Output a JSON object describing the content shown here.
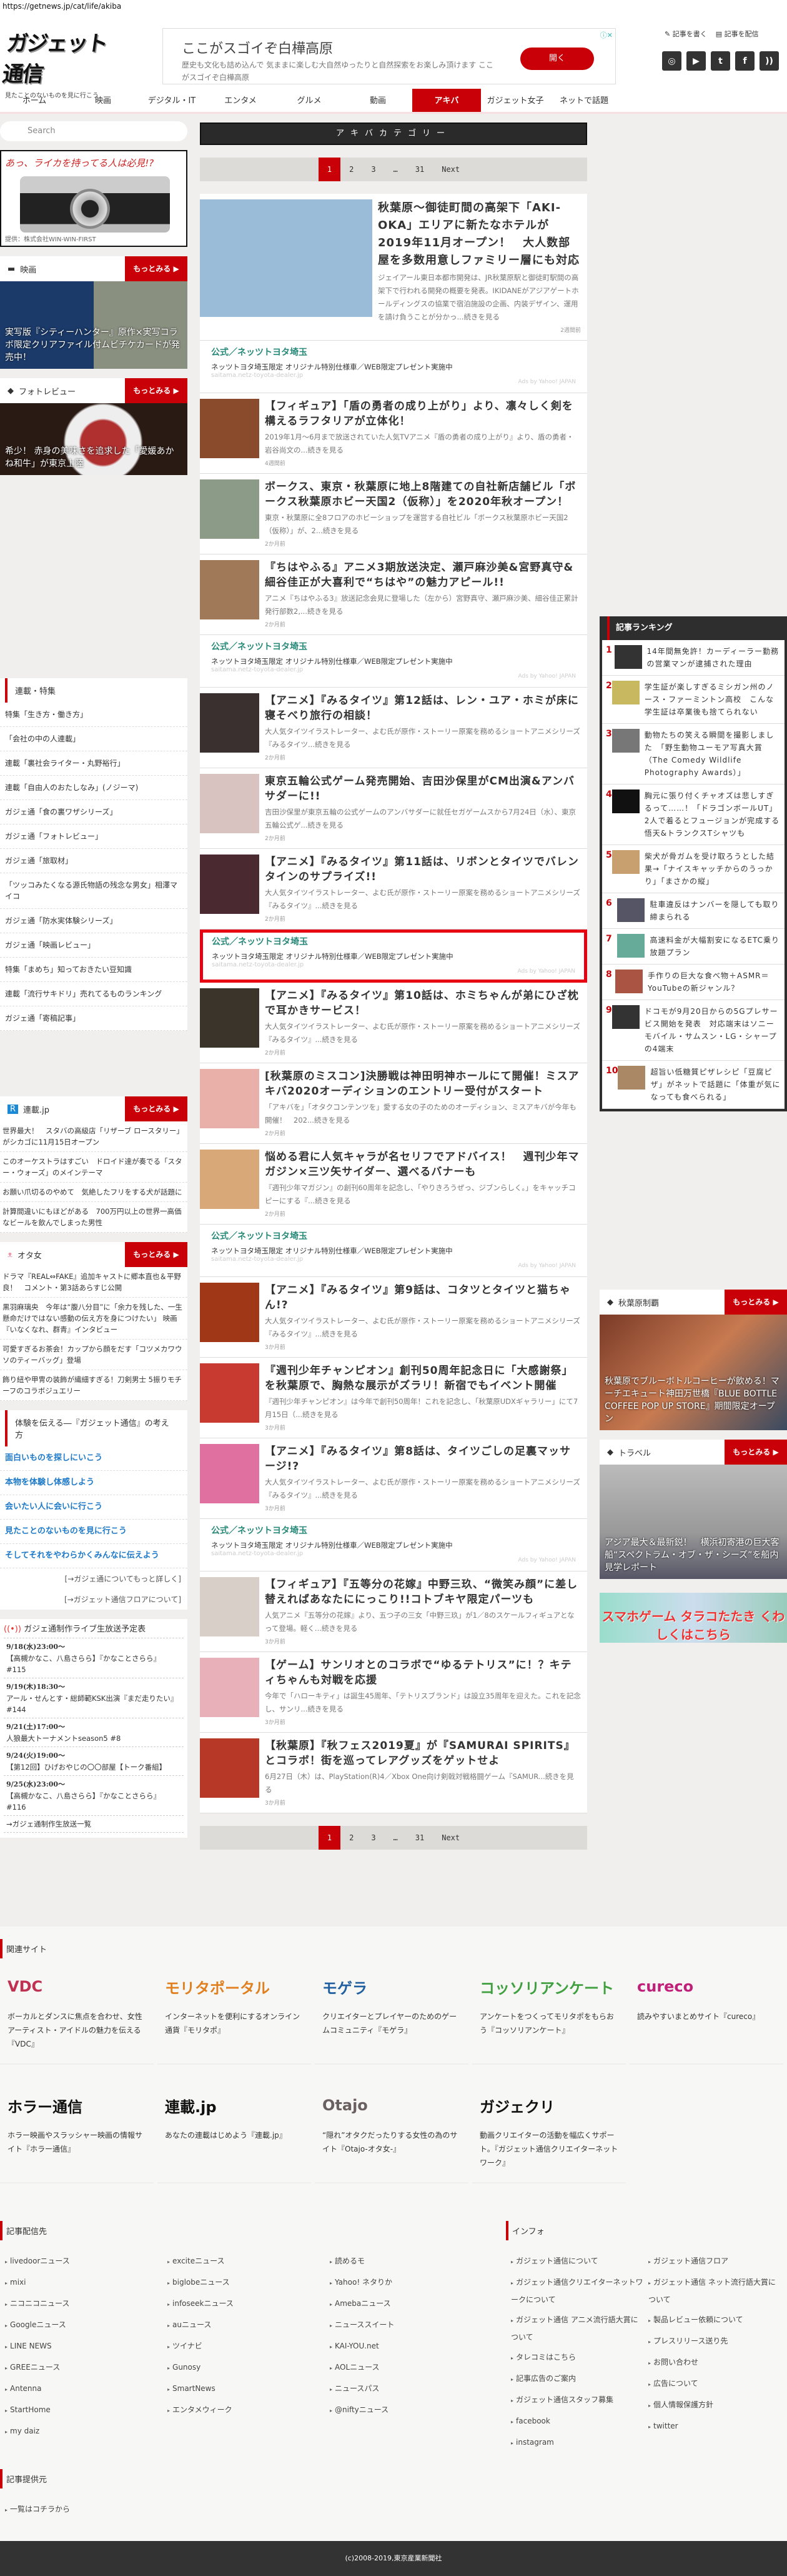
{
  "url": "https://getnews.jp/cat/life/akiba",
  "header": {
    "logo": "ガジェット通信",
    "tagline": "見たことのないものを見に行こう",
    "write": "記事を書く",
    "deliver": "記事を配信",
    "ad": {
      "title": "ここがスゴイぞ白樺高原",
      "desc": "歴史も文化も詰め込んで 気ままに楽しむ大自然ゆったりと自然探索をお楽しみ頂けます ここがスゴイぞ白樺高原",
      "button": "開く"
    },
    "social": [
      "instagram-icon",
      "youtube-icon",
      "twitter-icon",
      "facebook-icon",
      "rss-icon"
    ]
  },
  "nav": [
    {
      "label": "ホーム"
    },
    {
      "label": "映画"
    },
    {
      "label": "デジタル・IT"
    },
    {
      "label": "エンタメ"
    },
    {
      "label": "グルメ"
    },
    {
      "label": "動画"
    },
    {
      "label": "アキバ",
      "active": true
    },
    {
      "label": "ガジェット女子"
    },
    {
      "label": "ネットで話題"
    }
  ],
  "search": {
    "placeholder": "Search"
  },
  "side_ad": {
    "headline": "あっ、ライカを持ってる人は必見!?",
    "credit": "提供：株式会社WIN-WIN-FIRST"
  },
  "more": "もっとみる ▶",
  "movie": {
    "label": "映画",
    "caption": "実写版『シティーハンター』原作×実写コラボ限定クリアファイル付ムビチケカードが発売中！"
  },
  "photo": {
    "label": "フォトレビュー",
    "caption": "希少！ 赤身の美味さを追求した「愛媛あかね和牛」が東京上陸"
  },
  "series": {
    "label": "連載・特集",
    "items": [
      "特集「生き方・働き方」",
      "「会社の中の人連載」",
      "連載「裏社会ライター・丸野裕行」",
      "連載「自由人のおたしなみ」(ノジーマ)",
      "ガジェ通「食の裏ワザシリーズ」",
      "ガジェ通「フォトレビュー」",
      "ガジェ通「旅取材」",
      "「ツッコみたくなる源氏物語の残念な男女」相澤マイコ",
      "ガジェ通「防水実体験シリーズ」",
      "ガジェ通「映画レビュー」",
      "特集「まめち」知っておきたい豆知識",
      "連載「流行サキドリ」売れてるものランキング",
      "ガジェ通「寄稿記事」"
    ]
  },
  "rensai": {
    "label": "連載.jp",
    "items": [
      "世界最大！　スタバの高級店「リザーブ ロースタリー」がシカゴに11月15日オープン",
      "このオーケストラはすごい　ドロイド達が奏でる「スター・ウォーズ」のメインテーマ",
      "お願い爪切るのやめて　気絶したフリをする犬が話題に",
      "計算間違いにもほどがある　700万円以上の世界一高価なビールを飲んでしまった男性"
    ]
  },
  "otajo": {
    "label": "オタ女",
    "items": [
      "ドラマ『REAL⇔FAKE』追加キャストに郷本直也＆平野良！　コメント・第3話あらすじ公開",
      "黒羽麻璃央　今年は“腹八分目”に「余力を残した、一生懸命だけではない感動の伝え方を身につけたい」 映画『いなくなれ、群青』インタビュー",
      "可愛すぎるお茶会！カップから顔をだす「コツメカワウソのティーバッグ」登場",
      "飾り紐や甲冑の装飾が繊細すぎる！刀剣男士 5振りモチーフのコラボジュエリー"
    ]
  },
  "philosophy": {
    "label": "体験を伝える―『ガジェット通信』の考え方",
    "items": [
      "面白いものを探しにいこう",
      "本物を体験し体感しよう",
      "会いたい人に会いに行こう",
      "見たことのないものを見に行こう",
      "そしてそれをやわらかくみんなに伝えよう"
    ],
    "more1": "[→ガジェ通についてもっと詳しく]",
    "more2": "[→ガジェット通信フロアについて]"
  },
  "live": {
    "label": "ガジェ通制作ライブ生放送予定表",
    "items": [
      {
        "date": "9/18(水)23:00～",
        "title": "【高槻かなこ、八島さらら】『かなことさらら』 #115"
      },
      {
        "date": "9/19(木)18:30～",
        "title": "アール・せんとす・総師範KSK出演『まだ走りたい』#144"
      },
      {
        "date": "9/21(土)17:00～",
        "title": "人狼最大トーナメントseason5 #8"
      },
      {
        "date": "9/24(火)19:00～",
        "title": "【第12回】ひげおやじの〇〇部屋【トーク番組】"
      },
      {
        "date": "9/25(水)23:00～",
        "title": "【高槻かなこ、八島さらら】『かなことさらら』 #116"
      }
    ],
    "all": "→ガジェ通制作生放送一覧"
  },
  "category_title": "アキバカテゴリー",
  "pagination": {
    "pages": [
      "1",
      "2",
      "3",
      "…",
      "31"
    ],
    "current": "1",
    "next": "Next"
  },
  "ad_unit": {
    "title": "公式／ネッツトヨタ埼玉",
    "desc": "ネッツトヨタ埼玉限定 オリジナル特別仕様車／WEB限定プレゼント実施中",
    "domain": "saitama.netz-toyota-dealer.jp",
    "by": "Ads by Yahoo! JAPAN"
  },
  "articles": [
    {
      "type": "big",
      "title": "秋葉原～御徒町間の高架下「AKI-OKA」エリアに新たなホテルが2019年11月オープン！　大人数部屋を多数用意しファミリー層にも対応",
      "excerpt": "ジェイアール東日本都市開発は、JR秋葉原駅と御徒町駅間の高架下で行われる開発の概要を発表。IKIDANEがアジアゲートホールディングスの協業で宿泊施設の企画、内装デザイン、運用を請け負うことが分かっ...続きを見る",
      "time": "2週間前",
      "color": "#9bbcd8"
    },
    {
      "type": "ad"
    },
    {
      "title": "【フィギュア】「盾の勇者の成り上がり」より、凛々しく剣を構えるラフタリアが立体化！",
      "excerpt": "2019年1月～6月まで放送されていた人気TVアニメ『盾の勇者の成り上がり』より、盾の勇者・岩谷尚文の...続きを見る",
      "time": "4週間前",
      "color": "#8a4a2c"
    },
    {
      "title": "ボークス、東京・秋葉原に地上8階建ての自社新店舗ビル「ボークス秋葉原ホビー天国2（仮称）」を2020年秋オープン！",
      "excerpt": "東京・秋葉原に全8フロアのホビーショップを運営する自社ビル「ボークス秋葉原ホビー天国2（仮称）」が、2...続きを見る",
      "time": "2か月前",
      "color": "#8c9a88"
    },
    {
      "title": "『ちはやふる』アニメ3期放送決定、瀬戸麻沙美&宮野真守&細谷佳正が大喜利で“ちはや”の魅力アピール!!",
      "excerpt": "アニメ『ちはやふる3』放送記念会見に登場した（左から）宮野真守、瀬戸麻沙美、細谷佳正累計発行部数2,...続きを見る",
      "time": "2か月前",
      "color": "#a07a58"
    },
    {
      "type": "ad"
    },
    {
      "title": "【アニメ】『みるタイツ』第12話は、レン・ユア・ホミが床に寝そべり旅行の相談！",
      "excerpt": "大人気タイツイラストレーター、よむ氏が原作・ストーリー原案を務めるショートアニメシリーズ『みるタイツ...続きを見る",
      "time": "2か月前",
      "color": "#3a3030"
    },
    {
      "title": "東京五輪公式ゲーム発売開始、吉田沙保里がCM出演&アンバサダーに!!",
      "excerpt": "吉田沙保里が東京五輪の公式ゲームのアンバサダーに就任セガゲームスから7月24日（水）、東京五輪公式ゲ...続きを見る",
      "time": "2か月前",
      "color": "#d9c3c0"
    },
    {
      "title": "【アニメ】『みるタイツ』第11話は、リボンとタイツでバレンタインのサプライズ!!",
      "excerpt": "大人気タイツイラストレーター、よむ氏が原作・ストーリー原案を務めるショートアニメシリーズ『みるタイツ』...続きを見る",
      "time": "2か月前",
      "color": "#4a2a30"
    },
    {
      "type": "ad",
      "highlight": true
    },
    {
      "title": "【アニメ】『みるタイツ』第10話は、ホミちゃんが弟にひざ枕で耳かきサービス！",
      "excerpt": "大人気タイツイラストレーター、よむ氏が原作・ストーリー原案を務めるショートアニメシリーズ『みるタイツ』...続きを見る",
      "time": "2か月前",
      "color": "#3a342a"
    },
    {
      "title": "[秋葉原のミスコン]決勝戦は神田明神ホールにて開催！ミスアキバ2020オーディションのエントリー受付がスタート",
      "excerpt": "「アキバを」「オタクコンテンツを」愛する女の子のためのオーディション、ミスアキバが今年も開催！　202...続きを見る",
      "time": "2か月前",
      "color": "#e8b0a8"
    },
    {
      "title": "悩める君に人気キャラが名セリフでアドバイス！　週刊少年マガジン×三ツ矢サイダー、選べるバナーも",
      "excerpt": "『週刊少年マガジン』の創刊60周年を記念し、「やりきろうぜっ、ジブンらしく。」をキャッチコピーにする『...続きを見る",
      "time": "2か月前",
      "color": "#d8a878"
    },
    {
      "type": "ad"
    },
    {
      "title": "【アニメ】『みるタイツ』第9話は、コタツとタイツと猫ちゃん!?",
      "excerpt": "大人気タイツイラストレーター、よむ氏が原作・ストーリー原案を務めるショートアニメシリーズ『みるタイツ』...続きを見る",
      "time": "3か月前",
      "color": "#a03818"
    },
    {
      "title": "『週刊少年チャンピオン』創刊50周年記念日に「大感謝祭」を秋葉原で、胸熱な展示がズラリ！新宿でもイベント開催",
      "excerpt": "『週刊少年チャンピオン』は今年で創刊50周年！これを記念し、「秋葉原UDXギャラリー」にて7月15日（...続きを見る",
      "time": "3か月前",
      "color": "#c83a30"
    },
    {
      "title": "【アニメ】『みるタイツ』第8話は、タイツごしの足裏マッサージ!?",
      "excerpt": "大人気タイツイラストレーター、よむ氏が原作・ストーリー原案を務めるショートアニメシリーズ『みるタイツ』...続きを見る",
      "time": "3か月前",
      "color": "#e070a0"
    },
    {
      "type": "ad"
    },
    {
      "title": "【フィギュア】『五等分の花嫁』中野三玖、“微笑み顔”に差し替えればあなたににっこり!!コトブキヤ限定パーツも",
      "excerpt": "人気アニメ『五等分の花嫁』より、五つ子の三女「中野三玖」が1／8のスケールフィギュアとなって登場。軽く...続きを見る",
      "time": "3か月前",
      "color": "#d8d0c8"
    },
    {
      "title": "【ゲーム】サンリオとのコラボで“ゆるテトリス”に！？キティちゃんも対戦を応援",
      "excerpt": "今年で「ハローキティ」は誕生45周年、「テトリスブランド」は設立35周年を迎えた。これを記念し、サンリ...続きを見る",
      "time": "3か月前",
      "color": "#e8b0b8"
    },
    {
      "title": "【秋葉原】『秋フェス2019夏』が『SAMURAI SPIRITS』とコラボ！街を巡ってレアグッズをゲットせよ",
      "excerpt": "6月27日（木）は、PlayStation(R)4／Xbox One向け剣戟対戦格闘ゲーム『SAMUR...続きを見る",
      "time": "3か月前",
      "color": "#b83828"
    }
  ],
  "ranking": {
    "label": "記事ランキング",
    "items": [
      {
        "n": "1",
        "title": "14年間無免許！カーディーラー勤務の営業マンが逮捕された理由",
        "color": "#333"
      },
      {
        "n": "2",
        "title": "学生証が楽しすぎるミシガン州のノース・ファーミントン高校　こんな学生証は卒業後も捨てられない",
        "color": "#c8b860"
      },
      {
        "n": "3",
        "title": "動物たちの笑える瞬間を撮影しました　「野生動物ユーモア写真大賞（The Comedy Wildlife Photography Awards）」",
        "color": "#777"
      },
      {
        "n": "4",
        "title": "胸元に張り付くチャオズは悲しすぎるって……！「ドラゴンボールUT」2人で着るとフュージョンが完成する悟天&トランクスTシャツも",
        "color": "#111"
      },
      {
        "n": "5",
        "title": "柴犬が骨ガムを受け取ろうとした結果→「ナイスキャッチからのうっかり」「まさかの縦」",
        "color": "#c8a070"
      },
      {
        "n": "6",
        "title": "駐車違反はナンバーを隠しても取り締まられる",
        "color": "#556"
      },
      {
        "n": "7",
        "title": "高速料金が大幅割安になるETC乗り放題プラン",
        "color": "#6a9"
      },
      {
        "n": "8",
        "title": "手作りの巨大な食べ物＋ASMR＝YouTubeの新ジャンル？",
        "color": "#a54"
      },
      {
        "n": "9",
        "title": "ドコモが9月20日からの5Gプレサービス開始を発表　対応端末はソニーモバイル・サムスン・LG・シャープの4端末",
        "color": "#333"
      },
      {
        "n": "10",
        "title": "超旨い低糖質ピザレシピ「豆腐ピザ」がネットで話題に「体重が気になっても食べられる」",
        "color": "#a86"
      }
    ]
  },
  "akiba_seiha": {
    "label": "秋葉原制覇",
    "caption": "秋葉原でブルーボトルコーヒーが飲める！マーチエキュート神田万世橋『BLUE BOTTLE COFFEE POP UP STORE』期間限定オープン"
  },
  "travel": {
    "label": "トラベル",
    "caption": "アジア最大＆最新鋭！　横浜初寄港の巨大客船“スペクトラム・オブ・ザ・シーズ”を船内見学レポート"
  },
  "tarako": {
    "text": "スマホゲーム タラコたたき くわしくはこちら"
  },
  "footer": {
    "related_label": "関連サイト",
    "sites": [
      {
        "logo": "VDC",
        "color": "#c03050",
        "desc": "ボーカルとダンスに焦点を合わせ、女性アーティスト・アイドルの魅力を伝える『VDC』"
      },
      {
        "logo": "モリタポータル",
        "color": "#e08020",
        "desc": "インターネットを便利にするオンライン通貨『モリタポ』"
      },
      {
        "logo": "モゲラ",
        "color": "#2060a0",
        "desc": "クリエイターとプレイヤーのためのゲームコミュニティ『モゲラ』"
      },
      {
        "logo": "コッソリアンケート",
        "color": "#40a040",
        "desc": "アンケートをつくってモリタポをもらおう『コッソリアンケート』"
      },
      {
        "logo": "cureco",
        "color": "#c0207a",
        "desc": "読みやすいまとめサイト『cureco』"
      },
      {
        "logo": "ホラー通信",
        "color": "#111",
        "desc": "ホラー映画やスラッシャー映画の情報サイト『ホラー通信』"
      },
      {
        "logo": "連載.jp",
        "color": "#111",
        "desc": "あなたの連載はじめよう『連載.jp』"
      },
      {
        "logo": "Otajo",
        "color": "#6a6060",
        "desc": "“隠れ”オタクだったりする女性の為のサイト『Otajo-オタ女-』"
      },
      {
        "logo": "ガジェクリ",
        "color": "#111",
        "desc": "動画クリエイターの活動を幅広くサポート。『ガジェット通信クリエイターネットワーク』"
      }
    ],
    "dist_label": "記事配信先",
    "dist": [
      [
        "livedoorニュース",
        "mixi",
        "ニコニコニュース",
        "Googleニュース",
        "LINE NEWS",
        "GREEニュース",
        "Antenna",
        "StartHome",
        "my daiz"
      ],
      [
        "exciteニュース",
        "biglobeニュース",
        "infoseekニュース",
        "auニュース",
        "ツイナビ",
        "Gunosy",
        "SmartNews",
        "エンタメウィーク"
      ],
      [
        "読めるモ",
        "Yahoo! ネタりか",
        "Amebaニュース",
        "ニューススイート",
        "KAI-YOU.net",
        "AOLニュース",
        "ニュースパス",
        "@niftyニュース"
      ]
    ],
    "info_label": "インフォ",
    "info": [
      [
        "ガジェット通信について",
        "ガジェット通信クリエイターネットワークについて",
        "ガジェット通信 アニメ流行語大賞について",
        "タレコミはこちら",
        "記事広告のご案内",
        "ガジェット通信スタッフ募集",
        "facebook",
        "instagram"
      ],
      [
        "ガジェット通信フロア",
        "ガジェット通信 ネット流行語大賞について",
        "製品レビュー依頼について",
        "プレスリリース送り先",
        "お問い合わせ",
        "広告について",
        "個人情報保護方針",
        "twitter"
      ]
    ],
    "source_label": "記事提供元",
    "source_link": "一覧はコチラから",
    "copyright": "(c)2008-2019,東京産業新聞社"
  }
}
